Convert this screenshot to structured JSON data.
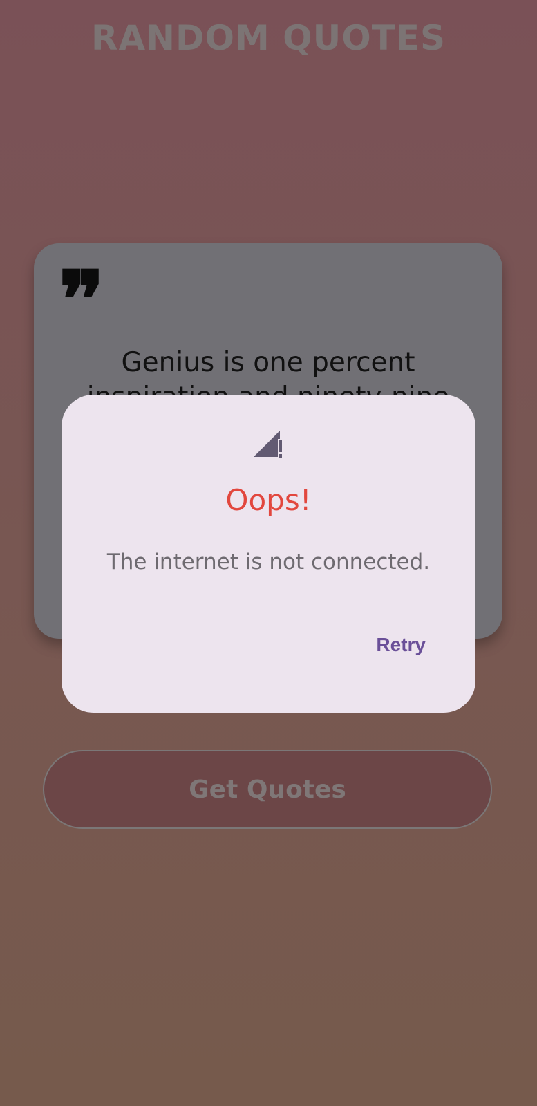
{
  "app": {
    "title": "RANDOM QUOTES"
  },
  "quote_card": {
    "quote_icon": "format-quote-icon",
    "quote_mark": "❞",
    "text": "Genius is one percent inspiration and ninety-nine percent perspiration."
  },
  "get_quotes_button": {
    "label": "Get Quotes"
  },
  "dialog": {
    "icon": "signal-cellular-connected-no-internet-icon",
    "title": "Oops!",
    "message": "The internet is not connected.",
    "retry_label": "Retry"
  },
  "colors": {
    "background": "#785752",
    "card": "#717075",
    "dialog": "#ede4ee",
    "error_title": "#e2473e",
    "accent": "#6a4f98"
  }
}
